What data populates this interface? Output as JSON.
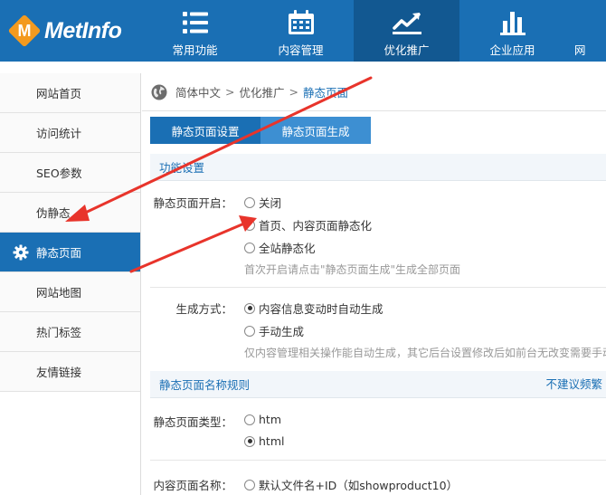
{
  "header": {
    "logo_letter": "M",
    "logo_text": "MetInfo",
    "nav": [
      {
        "label": "常用功能",
        "icon": "list-icon"
      },
      {
        "label": "内容管理",
        "icon": "calendar-icon"
      },
      {
        "label": "优化推广",
        "icon": "trend-chart-icon",
        "active": true
      },
      {
        "label": "企业应用",
        "icon": "bar-chart-icon"
      },
      {
        "label": "网",
        "icon": "partial-icon"
      }
    ]
  },
  "sidebar": {
    "items": [
      {
        "label": "网站首页"
      },
      {
        "label": "访问统计"
      },
      {
        "label": "SEO参数"
      },
      {
        "label": "伪静态"
      },
      {
        "label": "静态页面",
        "active": true
      },
      {
        "label": "网站地图"
      },
      {
        "label": "热门标签"
      },
      {
        "label": "友情链接"
      }
    ]
  },
  "breadcrumb": {
    "items": [
      "简体中文",
      "优化推广",
      "静态页面"
    ],
    "separator": ">"
  },
  "tabs": [
    {
      "label": "静态页面设置",
      "active": true
    },
    {
      "label": "静态页面生成"
    }
  ],
  "function_settings": {
    "section_title": "功能设置",
    "open_label": "静态页面开启：",
    "open_options": [
      {
        "label": "关闭",
        "checked": false
      },
      {
        "label": "首页、内容页面静态化",
        "checked": false
      },
      {
        "label": "全站静态化",
        "checked": false
      }
    ],
    "open_hint": "首次开启请点击\"静态页面生成\"生成全部页面",
    "mode_label": "生成方式：",
    "mode_options": [
      {
        "label": "内容信息变动时自动生成",
        "checked": true
      },
      {
        "label": "手动生成",
        "checked": false
      }
    ],
    "mode_hint": "仅内容管理相关操作能自动生成，其它后台设置修改后如前台无改变需要手动"
  },
  "name_rules": {
    "section_title": "静态页面名称规则",
    "right_note": "不建议频繁",
    "type_label": "静态页面类型：",
    "type_options": [
      {
        "label": "htm",
        "checked": false
      },
      {
        "label": "html",
        "checked": true
      }
    ],
    "content_name_label": "内容页面名称：",
    "content_name_options": [
      {
        "label": "默认文件名+ID（如showproduct10）",
        "checked": false
      }
    ]
  },
  "colors": {
    "header_bg": "#1a6fb4",
    "nav_active_bg": "#125891",
    "logo_orange": "#f39a1f",
    "annotation_arrow": "#e8342b"
  }
}
